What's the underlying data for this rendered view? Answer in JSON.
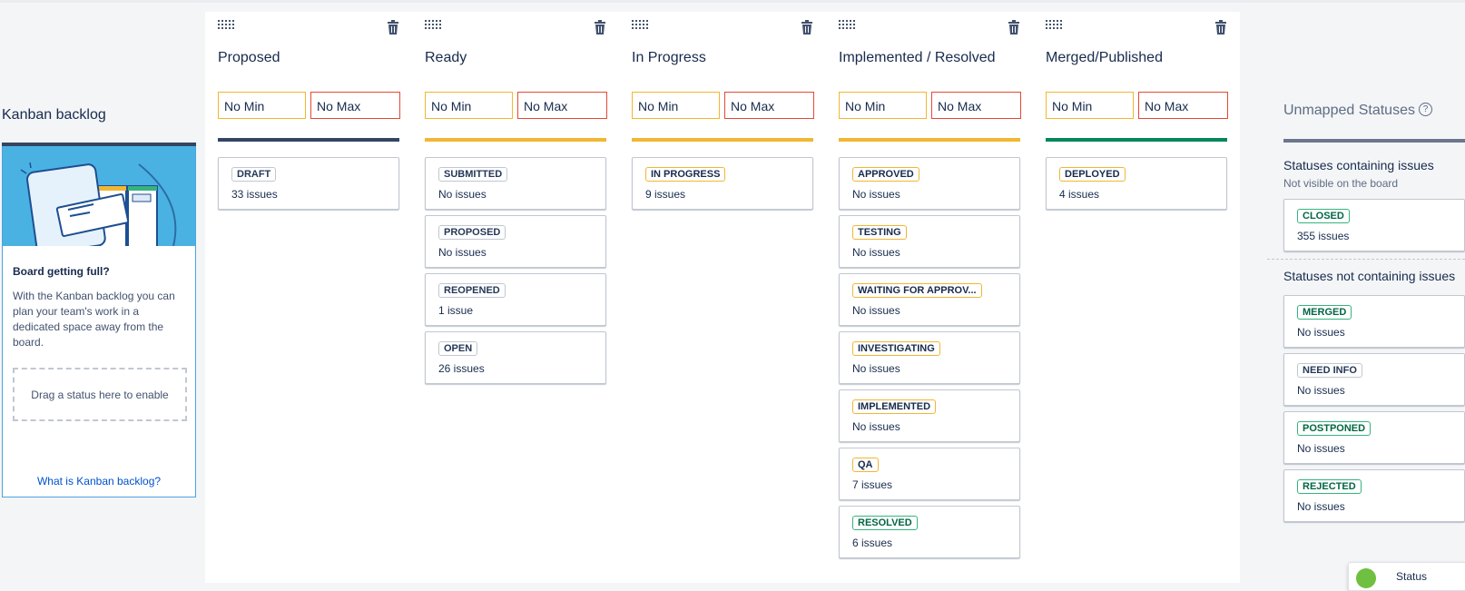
{
  "colors": {
    "min_border": "#f2b632",
    "max_border": "#e34935",
    "category_todo": "#344563",
    "category_inprogress": "#f2b632",
    "category_done": "#00875a",
    "link": "#0052cc"
  },
  "kanban_backlog": {
    "title": "Kanban backlog",
    "heading": "Board getting full?",
    "text": "With the Kanban backlog you can plan your team's work in a dedicated space away from the board.",
    "drop_text": "Drag a status here to enable",
    "link": "What is Kanban backlog?"
  },
  "column_icons": {
    "drag": "drag-handle-icon",
    "delete": "trash-icon"
  },
  "columns": [
    {
      "title": "Proposed",
      "min": "No Min",
      "max": "No Max",
      "bar_color": "#344563",
      "statuses": [
        {
          "name": "DRAFT",
          "count": "33 issues",
          "category": "blue"
        }
      ]
    },
    {
      "title": "Ready",
      "min": "No Min",
      "max": "No Max",
      "bar_color": "#f2b632",
      "statuses": [
        {
          "name": "SUBMITTED",
          "count": "No issues",
          "category": "blue"
        },
        {
          "name": "PROPOSED",
          "count": "No issues",
          "category": "blue"
        },
        {
          "name": "REOPENED",
          "count": "1 issue",
          "category": "blue"
        },
        {
          "name": "OPEN",
          "count": "26 issues",
          "category": "blue"
        }
      ]
    },
    {
      "title": "In Progress",
      "min": "No Min",
      "max": "No Max",
      "bar_color": "#f2b632",
      "statuses": [
        {
          "name": "IN PROGRESS",
          "count": "9 issues",
          "category": "yellow"
        }
      ]
    },
    {
      "title": "Implemented / Resolved",
      "min": "No Min",
      "max": "No Max",
      "bar_color": "#f2b632",
      "statuses": [
        {
          "name": "APPROVED",
          "count": "No issues",
          "category": "yellow"
        },
        {
          "name": "TESTING",
          "count": "No issues",
          "category": "yellow"
        },
        {
          "name": "WAITING FOR APPROV...",
          "count": "No issues",
          "category": "yellow"
        },
        {
          "name": "INVESTIGATING",
          "count": "No issues",
          "category": "yellow"
        },
        {
          "name": "IMPLEMENTED",
          "count": "No issues",
          "category": "yellow"
        },
        {
          "name": "QA",
          "count": "7 issues",
          "category": "yellow"
        },
        {
          "name": "RESOLVED",
          "count": "6 issues",
          "category": "green"
        }
      ]
    },
    {
      "title": "Merged/Published",
      "min": "No Min",
      "max": "No Max",
      "bar_color": "#00875a",
      "statuses": [
        {
          "name": "DEPLOYED",
          "count": "4 issues",
          "category": "yellow"
        }
      ]
    }
  ],
  "unmapped": {
    "title": "Unmapped Statuses",
    "help_icon": "question-circle-icon",
    "with_issues_heading": "Statuses containing issues",
    "with_issues_sub": "Not visible on the board",
    "with_issues": [
      {
        "name": "CLOSED",
        "count": "355 issues",
        "category": "green"
      }
    ],
    "without_issues_heading": "Statuses not containing issues",
    "without_issues": [
      {
        "name": "MERGED",
        "count": "No issues",
        "category": "green"
      },
      {
        "name": "NEED INFO",
        "count": "No issues",
        "category": "blue"
      },
      {
        "name": "POSTPONED",
        "count": "No issues",
        "category": "green"
      },
      {
        "name": "REJECTED",
        "count": "No issues",
        "category": "green"
      }
    ]
  },
  "toast": {
    "icon": "plus-circle-icon",
    "text": "Status"
  }
}
